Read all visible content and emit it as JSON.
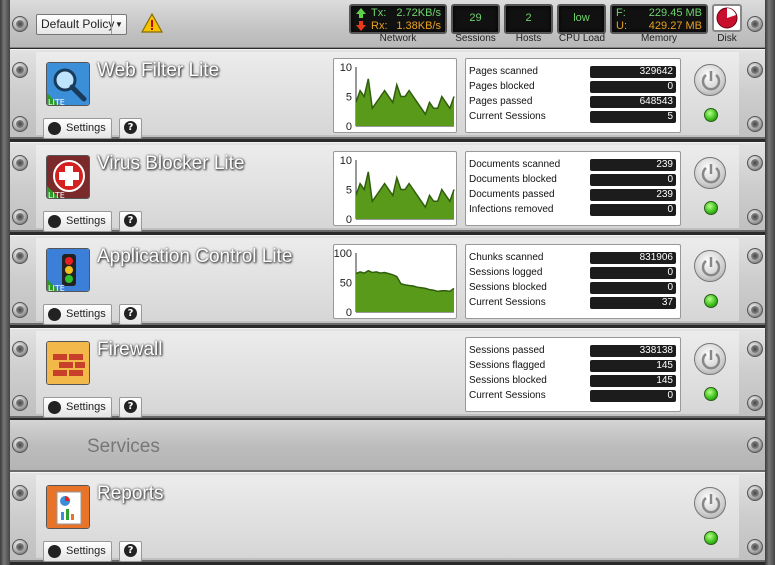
{
  "toolbar": {
    "policy": "Default Policy",
    "network": {
      "label": "Network",
      "tx_key": "Tx:",
      "tx_value": "2.72KB/s",
      "rx_key": "Rx:",
      "rx_value": "1.38KB/s"
    },
    "sessions": {
      "label": "Sessions",
      "value": "29"
    },
    "hosts": {
      "label": "Hosts",
      "value": "2"
    },
    "cpu": {
      "label": "CPU Load",
      "value": "low"
    },
    "memory": {
      "label": "Memory",
      "free_key": "F:",
      "free_value": "229.45 MB",
      "used_key": "U:",
      "used_value": "429.27 MB"
    },
    "disk": {
      "label": "Disk"
    }
  },
  "apps": [
    {
      "title": "Web Filter Lite",
      "icon": "magnifier-icon",
      "settings_label": "Settings",
      "help_label": "?",
      "graph": {
        "ymax": 10,
        "ticks": [
          "10",
          "5",
          "0"
        ],
        "values": [
          4,
          6,
          5,
          8,
          3,
          4,
          5,
          6,
          5,
          4,
          7,
          5,
          5,
          6,
          5,
          4,
          3,
          2,
          4,
          3,
          3,
          5,
          4,
          3,
          5
        ]
      },
      "stats": [
        {
          "label": "Pages scanned",
          "value": "329642"
        },
        {
          "label": "Pages blocked",
          "value": "0"
        },
        {
          "label": "Pages passed",
          "value": "648543"
        },
        {
          "label": "Current Sessions",
          "value": "5"
        }
      ]
    },
    {
      "title": "Virus Blocker Lite",
      "icon": "red-cross-icon",
      "settings_label": "Settings",
      "help_label": "?",
      "graph": {
        "ymax": 10,
        "ticks": [
          "10",
          "5",
          "0"
        ],
        "values": [
          4,
          6,
          5,
          8,
          3,
          4,
          5,
          6,
          5,
          4,
          7,
          5,
          5,
          6,
          5,
          4,
          3,
          2,
          4,
          3,
          3,
          5,
          4,
          3,
          5
        ]
      },
      "stats": [
        {
          "label": "Documents scanned",
          "value": "239"
        },
        {
          "label": "Documents blocked",
          "value": "0"
        },
        {
          "label": "Documents passed",
          "value": "239"
        },
        {
          "label": "Infections removed",
          "value": "0"
        }
      ]
    },
    {
      "title": "Application Control Lite",
      "icon": "traffic-light-icon",
      "settings_label": "Settings",
      "help_label": "?",
      "graph": {
        "ymax": 100,
        "ticks": [
          "100",
          "50",
          "0"
        ],
        "values": [
          65,
          68,
          66,
          70,
          67,
          68,
          66,
          67,
          65,
          63,
          60,
          48,
          46,
          45,
          44,
          42,
          41,
          40,
          38,
          37,
          35,
          36,
          36,
          35,
          40
        ]
      },
      "stats": [
        {
          "label": "Chunks scanned",
          "value": "831906"
        },
        {
          "label": "Sessions logged",
          "value": "0"
        },
        {
          "label": "Sessions blocked",
          "value": "0"
        },
        {
          "label": "Current Sessions",
          "value": "37"
        }
      ]
    },
    {
      "title": "Firewall",
      "icon": "brick-wall-icon",
      "settings_label": "Settings",
      "help_label": "?",
      "stats": [
        {
          "label": "Sessions passed",
          "value": "338138"
        },
        {
          "label": "Sessions flagged",
          "value": "145"
        },
        {
          "label": "Sessions blocked",
          "value": "145"
        },
        {
          "label": "Current Sessions",
          "value": "0"
        }
      ]
    }
  ],
  "services": {
    "title": "Services",
    "apps": [
      {
        "title": "Reports",
        "icon": "report-chart-icon",
        "settings_label": "Settings",
        "help_label": "?"
      }
    ]
  },
  "colors": {
    "graph_fill": "#5a9a1a",
    "graph_line": "#2f5e0c",
    "led_on": "#3fc21d"
  }
}
